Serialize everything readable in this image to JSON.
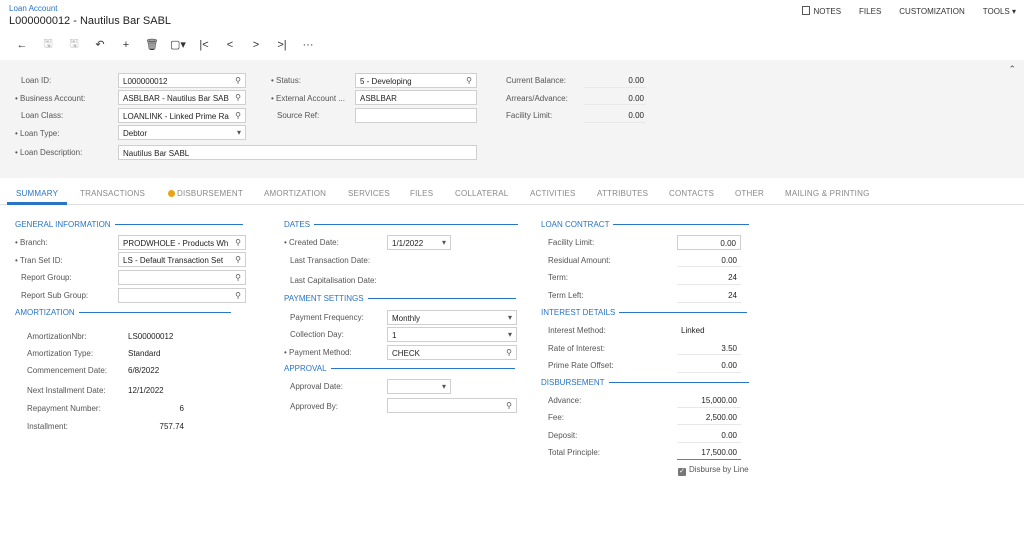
{
  "header": {
    "breadcrumb": "Loan Account",
    "title": "L000000012 - Nautilus Bar SABL",
    "links": {
      "notes": "NOTES",
      "files": "FILES",
      "customization": "CUSTOMIZATION",
      "tools": "TOOLS"
    }
  },
  "toolbar": {
    "back": "←",
    "save": "🖫",
    "save_close": "🖫",
    "undo": "↶",
    "add": "+",
    "delete": "🗑",
    "copy": "▢▾",
    "first": "|<",
    "prev": "<",
    "next": ">",
    "last": ">|",
    "more": "···"
  },
  "top_form": {
    "loan_id_label": "Loan ID:",
    "loan_id": "L000000012",
    "business_account_label": "Business Account:",
    "business_account": "ASBLBAR - Nautilus Bar SAB",
    "loan_class_label": "Loan Class:",
    "loan_class": "LOANLINK - Linked Prime Ra",
    "loan_type_label": "Loan Type:",
    "loan_type": "Debtor",
    "loan_description_label": "Loan Description:",
    "loan_description": "Nautilus Bar SABL",
    "status_label": "Status:",
    "status": "5 - Developing",
    "external_account_label": "External Account ...",
    "external_account": "ASBLBAR",
    "source_ref_label": "Source Ref:",
    "source_ref": "",
    "current_balance_label": "Current Balance:",
    "current_balance": "0.00",
    "arrears_label": "Arrears/Advance:",
    "arrears": "0.00",
    "facility_limit_label": "Facility Limit:",
    "facility_limit": "0.00"
  },
  "tabs": {
    "summary": "SUMMARY",
    "transactions": "TRANSACTIONS",
    "disbursement": "DISBURSEMENT",
    "amortization": "AMORTIZATION",
    "services": "SERVICES",
    "files": "FILES",
    "collateral": "COLLATERAL",
    "activities": "ACTIVITIES",
    "attributes": "ATTRIBUTES",
    "contacts": "CONTACTS",
    "other": "OTHER",
    "mailing": "MAILING & PRINTING"
  },
  "general": {
    "title": "GENERAL INFORMATION",
    "branch_label": "Branch:",
    "branch": "PRODWHOLE - Products Wh",
    "tran_set_label": "Tran Set ID:",
    "tran_set": "LS - Default Transaction Set",
    "report_group_label": "Report Group:",
    "report_group": "",
    "report_sub_group_label": "Report Sub Group:",
    "report_sub_group": ""
  },
  "amortization": {
    "title": "AMORTIZATION",
    "nbr_label": "AmortizationNbr:",
    "nbr": "LS00000012",
    "type_label": "Amortization Type:",
    "type": "Standard",
    "commencement_label": "Commencement Date:",
    "commencement": "6/8/2022",
    "next_installment_label": "Next Installment Date:",
    "next_installment": "12/1/2022",
    "repayment_number_label": "Repayment Number:",
    "repayment_number": "6",
    "installment_label": "Installment:",
    "installment": "757.74"
  },
  "dates": {
    "title": "DATES",
    "created_label": "Created Date:",
    "created": "1/1/2022",
    "last_tran_label": "Last Transaction Date:",
    "last_cap_label": "Last Capitalisation Date:"
  },
  "payment": {
    "title": "PAYMENT SETTINGS",
    "frequency_label": "Payment Frequency:",
    "frequency": "Monthly",
    "collection_day_label": "Collection Day:",
    "collection_day": "1",
    "method_label": "Payment Method:",
    "method": "CHECK"
  },
  "approval": {
    "title": "APPROVAL",
    "date_label": "Approval Date:",
    "date": "",
    "by_label": "Approved By:",
    "by": ""
  },
  "contract": {
    "title": "LOAN CONTRACT",
    "facility_limit_label": "Facility Limit:",
    "facility_limit": "0.00",
    "residual_label": "Residual Amount:",
    "residual": "0.00",
    "term_label": "Term:",
    "term": "24",
    "term_left_label": "Term Left:",
    "term_left": "24"
  },
  "interest": {
    "title": "INTEREST DETAILS",
    "method_label": "Interest Method:",
    "method": "Linked",
    "rate_label": "Rate of Interest:",
    "rate": "3.50",
    "prime_offset_label": "Prime Rate Offset:",
    "prime_offset": "0.00"
  },
  "disbursement": {
    "title": "DISBURSEMENT",
    "advance_label": "Advance:",
    "advance": "15,000.00",
    "fee_label": "Fee:",
    "fee": "2,500.00",
    "deposit_label": "Deposit:",
    "deposit": "0.00",
    "total_label": "Total Principle:",
    "total": "17,500.00",
    "by_line_label": "Disburse by Line"
  }
}
